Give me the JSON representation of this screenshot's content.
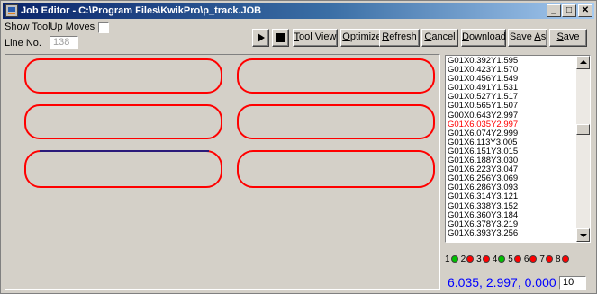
{
  "window": {
    "title": "Job Editor - C:\\Program Files\\KwikPro\\p_track.JOB",
    "minimize_glyph": "_",
    "maximize_glyph": "□",
    "close_glyph": "✕"
  },
  "options": {
    "show_toolup_label": "Show ToolUp Moves",
    "show_toolup_checked": false,
    "line_no_label": "Line No.",
    "line_no_value": "138"
  },
  "toolbar": {
    "play_icon": "play-icon",
    "stop_icon": "stop-icon",
    "tool_view_label": "Tool View",
    "optimize_label": "Optimize",
    "refresh_label": "Refresh",
    "cancel_label": "Cancel",
    "download_label": "Download",
    "save_as_label": "Save As",
    "save_label": "Save"
  },
  "code": {
    "lines": [
      "G01X0.392Y1.595",
      "G01X0.423Y1.570",
      "G01X0.456Y1.549",
      "G01X0.491Y1.531",
      "G01X0.527Y1.517",
      "G01X0.565Y1.507",
      "G00X0.643Y2.997",
      "G01X6.035Y2.997",
      "G01X6.074Y2.999",
      "G01X6.113Y3.005",
      "G01X6.151Y3.015",
      "G01X6.188Y3.030",
      "G01X6.223Y3.047",
      "G01X6.256Y3.069",
      "G01X6.286Y3.093",
      "G01X6.314Y3.121",
      "G01X6.338Y3.152",
      "G01X6.360Y3.184",
      "G01X6.378Y3.219",
      "G01X6.393Y3.256"
    ],
    "current_index": 7
  },
  "indicators": [
    {
      "num": "1",
      "color": "#00c000"
    },
    {
      "num": "2",
      "color": "#ff0000"
    },
    {
      "num": "3",
      "color": "#ff0000"
    },
    {
      "num": "4",
      "color": "#00c000"
    },
    {
      "num": "5",
      "color": "#ff0000"
    },
    {
      "num": "6",
      "color": "#ff0000"
    },
    {
      "num": "7",
      "color": "#ff0000"
    },
    {
      "num": "8",
      "color": "#ff0000"
    }
  ],
  "status": {
    "coordinates": "6.035, 2.997, 0.000",
    "zoom_value": "10"
  },
  "colors": {
    "toolpath": "#ff0000",
    "active_path": "#2a1a7a",
    "canvas_bg": "#d4d0c8"
  }
}
